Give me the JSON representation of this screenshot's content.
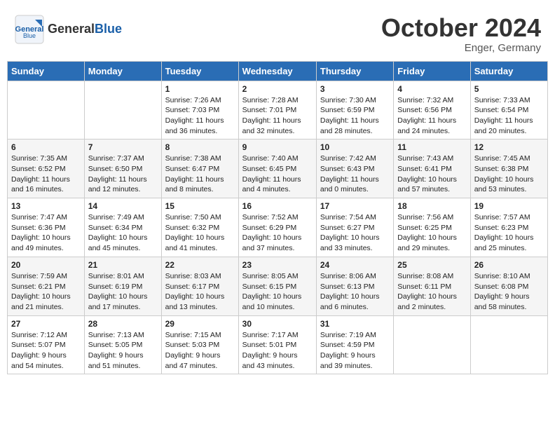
{
  "header": {
    "logo_line1": "General",
    "logo_line2": "Blue",
    "month": "October 2024",
    "location": "Enger, Germany"
  },
  "days_of_week": [
    "Sunday",
    "Monday",
    "Tuesday",
    "Wednesday",
    "Thursday",
    "Friday",
    "Saturday"
  ],
  "weeks": [
    [
      {
        "day": "",
        "info": ""
      },
      {
        "day": "",
        "info": ""
      },
      {
        "day": "1",
        "info": "Sunrise: 7:26 AM\nSunset: 7:03 PM\nDaylight: 11 hours\nand 36 minutes."
      },
      {
        "day": "2",
        "info": "Sunrise: 7:28 AM\nSunset: 7:01 PM\nDaylight: 11 hours\nand 32 minutes."
      },
      {
        "day": "3",
        "info": "Sunrise: 7:30 AM\nSunset: 6:59 PM\nDaylight: 11 hours\nand 28 minutes."
      },
      {
        "day": "4",
        "info": "Sunrise: 7:32 AM\nSunset: 6:56 PM\nDaylight: 11 hours\nand 24 minutes."
      },
      {
        "day": "5",
        "info": "Sunrise: 7:33 AM\nSunset: 6:54 PM\nDaylight: 11 hours\nand 20 minutes."
      }
    ],
    [
      {
        "day": "6",
        "info": "Sunrise: 7:35 AM\nSunset: 6:52 PM\nDaylight: 11 hours\nand 16 minutes."
      },
      {
        "day": "7",
        "info": "Sunrise: 7:37 AM\nSunset: 6:50 PM\nDaylight: 11 hours\nand 12 minutes."
      },
      {
        "day": "8",
        "info": "Sunrise: 7:38 AM\nSunset: 6:47 PM\nDaylight: 11 hours\nand 8 minutes."
      },
      {
        "day": "9",
        "info": "Sunrise: 7:40 AM\nSunset: 6:45 PM\nDaylight: 11 hours\nand 4 minutes."
      },
      {
        "day": "10",
        "info": "Sunrise: 7:42 AM\nSunset: 6:43 PM\nDaylight: 11 hours\nand 0 minutes."
      },
      {
        "day": "11",
        "info": "Sunrise: 7:43 AM\nSunset: 6:41 PM\nDaylight: 10 hours\nand 57 minutes."
      },
      {
        "day": "12",
        "info": "Sunrise: 7:45 AM\nSunset: 6:38 PM\nDaylight: 10 hours\nand 53 minutes."
      }
    ],
    [
      {
        "day": "13",
        "info": "Sunrise: 7:47 AM\nSunset: 6:36 PM\nDaylight: 10 hours\nand 49 minutes."
      },
      {
        "day": "14",
        "info": "Sunrise: 7:49 AM\nSunset: 6:34 PM\nDaylight: 10 hours\nand 45 minutes."
      },
      {
        "day": "15",
        "info": "Sunrise: 7:50 AM\nSunset: 6:32 PM\nDaylight: 10 hours\nand 41 minutes."
      },
      {
        "day": "16",
        "info": "Sunrise: 7:52 AM\nSunset: 6:29 PM\nDaylight: 10 hours\nand 37 minutes."
      },
      {
        "day": "17",
        "info": "Sunrise: 7:54 AM\nSunset: 6:27 PM\nDaylight: 10 hours\nand 33 minutes."
      },
      {
        "day": "18",
        "info": "Sunrise: 7:56 AM\nSunset: 6:25 PM\nDaylight: 10 hours\nand 29 minutes."
      },
      {
        "day": "19",
        "info": "Sunrise: 7:57 AM\nSunset: 6:23 PM\nDaylight: 10 hours\nand 25 minutes."
      }
    ],
    [
      {
        "day": "20",
        "info": "Sunrise: 7:59 AM\nSunset: 6:21 PM\nDaylight: 10 hours\nand 21 minutes."
      },
      {
        "day": "21",
        "info": "Sunrise: 8:01 AM\nSunset: 6:19 PM\nDaylight: 10 hours\nand 17 minutes."
      },
      {
        "day": "22",
        "info": "Sunrise: 8:03 AM\nSunset: 6:17 PM\nDaylight: 10 hours\nand 13 minutes."
      },
      {
        "day": "23",
        "info": "Sunrise: 8:05 AM\nSunset: 6:15 PM\nDaylight: 10 hours\nand 10 minutes."
      },
      {
        "day": "24",
        "info": "Sunrise: 8:06 AM\nSunset: 6:13 PM\nDaylight: 10 hours\nand 6 minutes."
      },
      {
        "day": "25",
        "info": "Sunrise: 8:08 AM\nSunset: 6:11 PM\nDaylight: 10 hours\nand 2 minutes."
      },
      {
        "day": "26",
        "info": "Sunrise: 8:10 AM\nSunset: 6:08 PM\nDaylight: 9 hours\nand 58 minutes."
      }
    ],
    [
      {
        "day": "27",
        "info": "Sunrise: 7:12 AM\nSunset: 5:07 PM\nDaylight: 9 hours\nand 54 minutes."
      },
      {
        "day": "28",
        "info": "Sunrise: 7:13 AM\nSunset: 5:05 PM\nDaylight: 9 hours\nand 51 minutes."
      },
      {
        "day": "29",
        "info": "Sunrise: 7:15 AM\nSunset: 5:03 PM\nDaylight: 9 hours\nand 47 minutes."
      },
      {
        "day": "30",
        "info": "Sunrise: 7:17 AM\nSunset: 5:01 PM\nDaylight: 9 hours\nand 43 minutes."
      },
      {
        "day": "31",
        "info": "Sunrise: 7:19 AM\nSunset: 4:59 PM\nDaylight: 9 hours\nand 39 minutes."
      },
      {
        "day": "",
        "info": ""
      },
      {
        "day": "",
        "info": ""
      }
    ]
  ]
}
